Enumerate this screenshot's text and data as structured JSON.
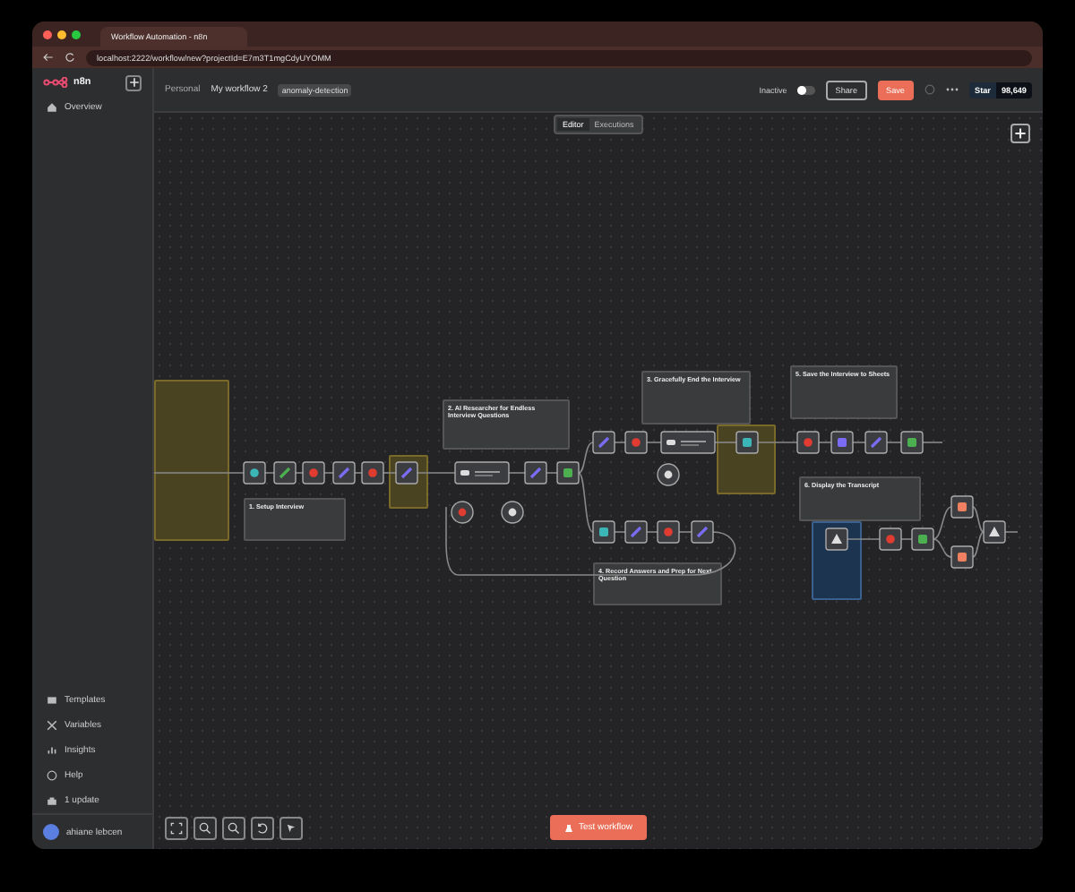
{
  "browser": {
    "tab_title": "Workflow Automation - n8n",
    "url": "localhost:2222/workflow/new?projectId=E7m3T1mgCdyUYOMM"
  },
  "sidebar": {
    "logo": "n8n",
    "items": [
      {
        "label": "Overview"
      }
    ],
    "bottom_items": [
      {
        "label": "Templates"
      },
      {
        "label": "Variables"
      },
      {
        "label": "Insights"
      },
      {
        "label": "Help"
      },
      {
        "label": "1 update"
      }
    ],
    "user": {
      "name": "ahiane lebcen"
    }
  },
  "header": {
    "project": "Personal",
    "workflow_name": "My workflow 2",
    "tag": "anomaly-detection",
    "active_label": "Inactive",
    "active": false,
    "share": "Share",
    "save": "Save",
    "github": {
      "label": "Star",
      "count": "98,649"
    }
  },
  "view_tabs": [
    {
      "label": "Editor",
      "selected": true
    },
    {
      "label": "Executions",
      "selected": false
    }
  ],
  "notes": [
    {
      "kind": "warning"
    },
    {
      "kind": "default",
      "title": "1. Setup Interview"
    },
    {
      "kind": "default",
      "title": "2. AI Researcher for Endless Interview Questions"
    },
    {
      "kind": "default",
      "title": "3. Gracefully End the Interview"
    },
    {
      "kind": "warning"
    },
    {
      "kind": "warning"
    },
    {
      "kind": "default",
      "title": "4. Record Answers and Prep for Next Question"
    },
    {
      "kind": "default",
      "title": "5. Save the Interview to Sheets"
    },
    {
      "kind": "default",
      "title": "6. Display the Transcript"
    },
    {
      "kind": "info"
    }
  ],
  "test_button": "Test workflow"
}
